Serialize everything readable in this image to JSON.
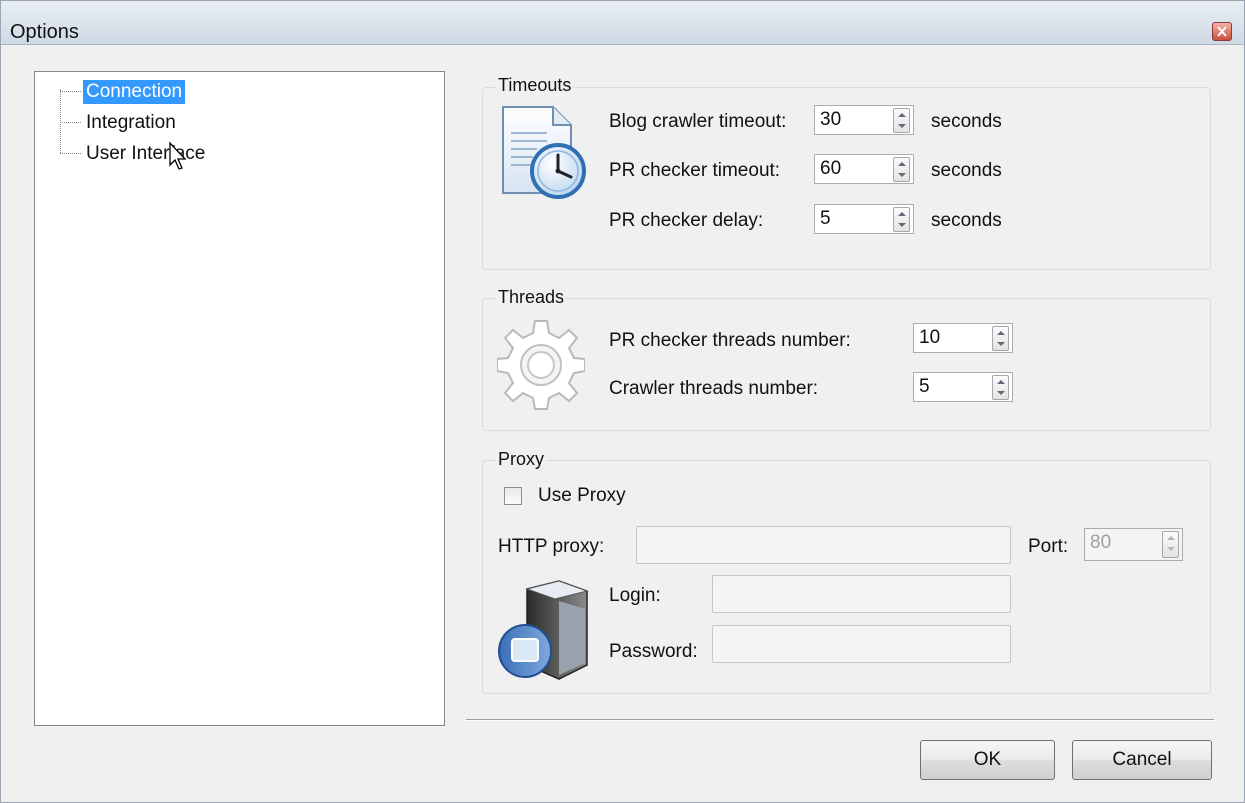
{
  "window": {
    "title": "Options"
  },
  "tree": {
    "items": [
      {
        "label": "Connection",
        "selected": true
      },
      {
        "label": "Integration",
        "selected": false
      },
      {
        "label": "User Interface",
        "selected": false
      }
    ]
  },
  "timeouts": {
    "title": "Timeouts",
    "rows": [
      {
        "label": "Blog crawler timeout:",
        "value": "30",
        "unit": "seconds"
      },
      {
        "label": "PR checker timeout:",
        "value": "60",
        "unit": "seconds"
      },
      {
        "label": "PR checker delay:",
        "value": "5",
        "unit": "seconds"
      }
    ],
    "icon": "clock-document-icon"
  },
  "threads": {
    "title": "Threads",
    "rows": [
      {
        "label": "PR checker threads number:",
        "value": "10"
      },
      {
        "label": "Crawler threads number:",
        "value": "5"
      }
    ],
    "icon": "gear-icon"
  },
  "proxy": {
    "title": "Proxy",
    "use_proxy_label": "Use Proxy",
    "use_proxy_checked": false,
    "http_proxy_label": "HTTP proxy:",
    "http_proxy_value": "",
    "port_label": "Port:",
    "port_value": "80",
    "login_label": "Login:",
    "login_value": "",
    "password_label": "Password:",
    "password_value": "",
    "icon": "server-icon"
  },
  "buttons": {
    "ok": "OK",
    "cancel": "Cancel"
  },
  "colors": {
    "selection": "#3399ff",
    "background": "#f0f0f0"
  }
}
